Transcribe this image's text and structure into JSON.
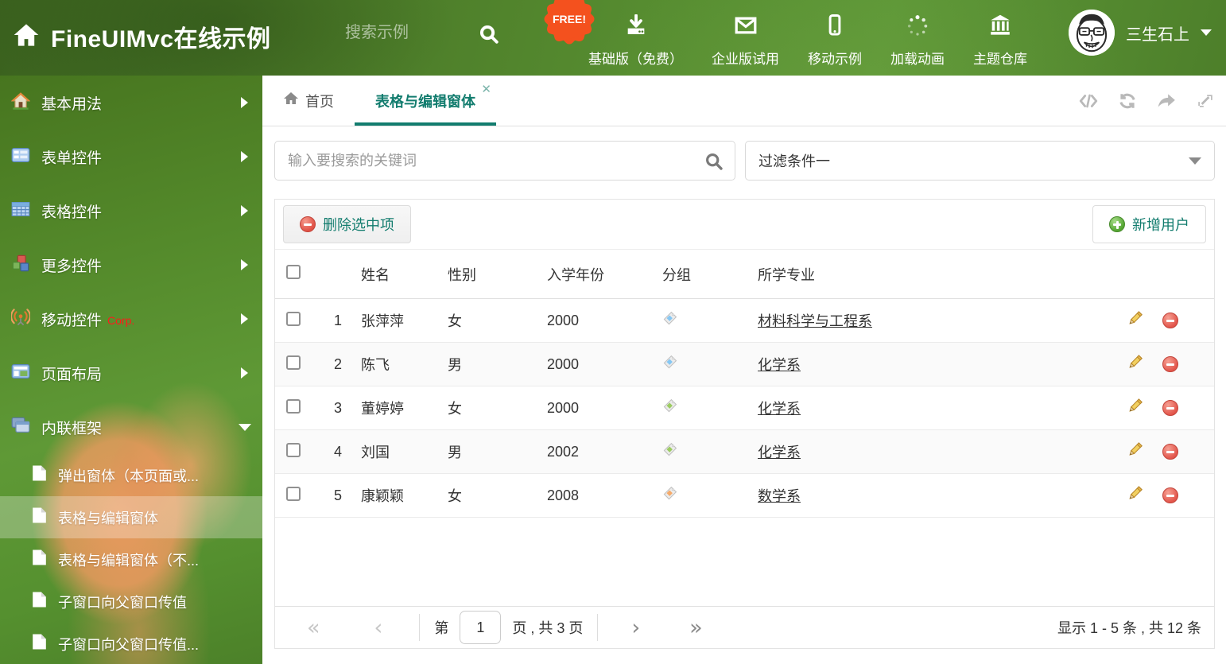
{
  "header": {
    "title": "FineUIMvc在线示例",
    "search_placeholder": "搜索示例",
    "free_badge": "FREE!",
    "nav_items": [
      {
        "icon": "download-icon",
        "label": "基础版（免费）"
      },
      {
        "icon": "envelope-icon",
        "label": "企业版试用"
      },
      {
        "icon": "mobile-icon",
        "label": "移动示例"
      },
      {
        "icon": "spinner-icon",
        "label": "加载动画"
      },
      {
        "icon": "bank-icon",
        "label": "主题仓库"
      }
    ],
    "username": "三生石上"
  },
  "sidebar": {
    "items": [
      {
        "icon": "home-icon",
        "label": "基本用法"
      },
      {
        "icon": "form-icon",
        "label": "表单控件"
      },
      {
        "icon": "table-icon",
        "label": "表格控件"
      },
      {
        "icon": "cubes-icon",
        "label": "更多控件"
      },
      {
        "icon": "antenna-icon",
        "label": "移动控件",
        "badge": "Corp."
      },
      {
        "icon": "layout-icon",
        "label": "页面布局"
      },
      {
        "icon": "frames-icon",
        "label": "内联框架"
      }
    ],
    "subitems": [
      {
        "label": "弹出窗体（本页面或..."
      },
      {
        "label": "表格与编辑窗体",
        "selected": true
      },
      {
        "label": "表格与编辑窗体（不..."
      },
      {
        "label": "子窗口向父窗口传值"
      },
      {
        "label": "子窗口向父窗口传值..."
      }
    ]
  },
  "tabs": [
    {
      "label": "首页"
    },
    {
      "label": "表格与编辑窗体",
      "active": true,
      "close": "✕"
    }
  ],
  "tab_tools": [
    "code-icon",
    "refresh-icon",
    "share-icon",
    "expand-icon"
  ],
  "toolbar": {
    "search_placeholder": "输入要搜索的关键词",
    "filter_value": "过滤条件一",
    "delete_button": "删除选中项",
    "add_button": "新增用户"
  },
  "grid": {
    "columns": {
      "name": "姓名",
      "gender": "性别",
      "year": "入学年份",
      "group": "分组",
      "major": "所学专业"
    },
    "rows": [
      {
        "num": "1",
        "name": "张萍萍",
        "gender": "女",
        "year": "2000",
        "tag_color": "#86c7f3",
        "major": "材料科学与工程系"
      },
      {
        "num": "2",
        "name": "陈飞",
        "gender": "男",
        "year": "2000",
        "tag_color": "#86c7f3",
        "major": "化学系"
      },
      {
        "num": "3",
        "name": "董婷婷",
        "gender": "女",
        "year": "2000",
        "tag_color": "#9ccb62",
        "major": "化学系"
      },
      {
        "num": "4",
        "name": "刘国",
        "gender": "男",
        "year": "2002",
        "tag_color": "#9ccb62",
        "major": "化学系"
      },
      {
        "num": "5",
        "name": "康颖颖",
        "gender": "女",
        "year": "2008",
        "tag_color": "#f5aa6a",
        "major": "数学系"
      }
    ]
  },
  "pagination": {
    "first": "«",
    "prev": "‹",
    "next": "›",
    "last": "»",
    "prefix": "第",
    "current_page": "1",
    "suffix": "页 , 共 3 页",
    "summary": "显示 1 - 5 条 , 共 12 条"
  },
  "colors": {
    "accent_teal": "#127c6e",
    "badge_orange": "#f4511e",
    "delete_red": "#e05045",
    "add_green": "#54a532",
    "corp_red": "#ff1a1a"
  }
}
